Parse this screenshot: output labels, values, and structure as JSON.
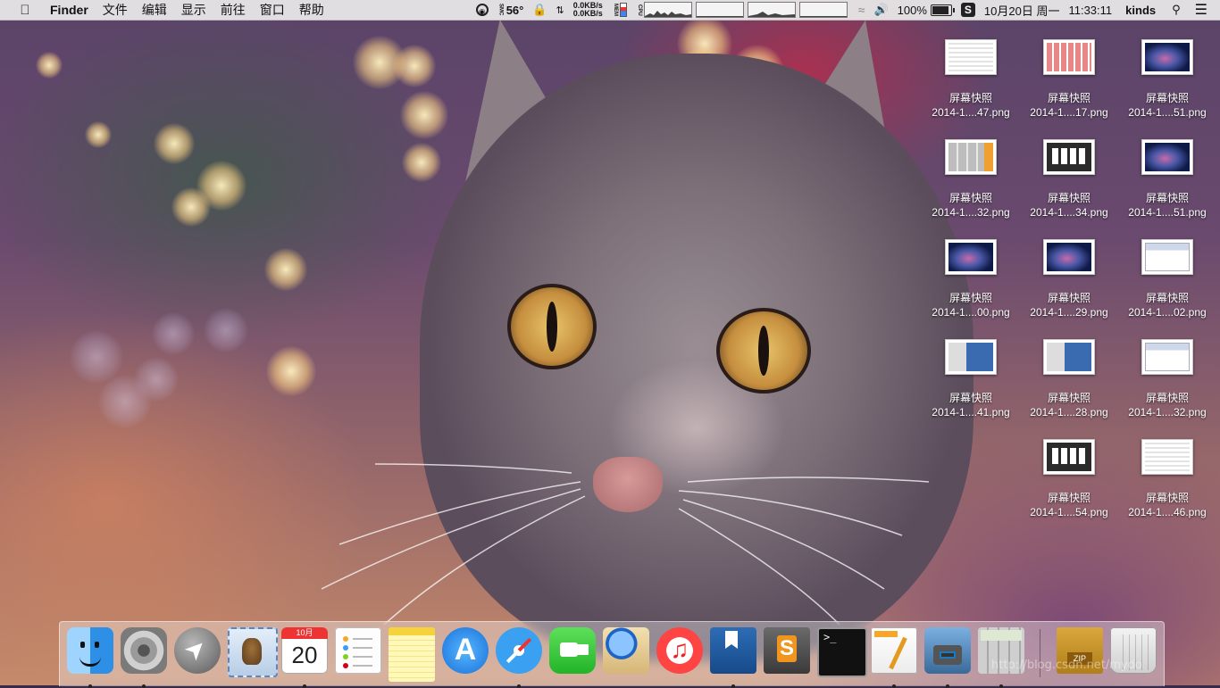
{
  "menubar": {
    "apple_icon": "apple-logo-icon",
    "app_name": "Finder",
    "menus": [
      "文件",
      "编辑",
      "显示",
      "前往",
      "窗口",
      "帮助"
    ],
    "status": {
      "istat_temp_prefix": "SMC",
      "temperature": "56°",
      "net_up": "0.0KB/s",
      "net_down": "0.0KB/s",
      "mem_label": "MEM",
      "cpu_label": "CPU",
      "battery_percent": "100%",
      "battery_level": 1.0,
      "input_method": "S",
      "date": "10月20日 周一",
      "time": "11:33:11",
      "user": "kinds"
    }
  },
  "desktop_icons": [
    {
      "name": "屏幕快照",
      "file": "2014-1....47.png",
      "thumb": "doc"
    },
    {
      "name": "屏幕快照",
      "file": "2014-1....17.png",
      "thumb": "grid"
    },
    {
      "name": "屏幕快照",
      "file": "2014-1....51.png",
      "thumb": "space"
    },
    {
      "name": "屏幕快照",
      "file": "2014-1....32.png",
      "thumb": "calc"
    },
    {
      "name": "屏幕快照",
      "file": "2014-1....34.png",
      "thumb": "dark"
    },
    {
      "name": "屏幕快照",
      "file": "2014-1....51.png",
      "thumb": "space"
    },
    {
      "name": "屏幕快照",
      "file": "2014-1....00.png",
      "thumb": "space"
    },
    {
      "name": "屏幕快照",
      "file": "2014-1....29.png",
      "thumb": "space"
    },
    {
      "name": "屏幕快照",
      "file": "2014-1....02.png",
      "thumb": "window"
    },
    {
      "name": "屏幕快照",
      "file": "2014-1....41.png",
      "thumb": "mixed"
    },
    {
      "name": "屏幕快照",
      "file": "2014-1....28.png",
      "thumb": "mixed"
    },
    {
      "name": "屏幕快照",
      "file": "2014-1....32.png",
      "thumb": "window"
    },
    {
      "name": "屏幕快照",
      "file": "2014-1....54.png",
      "thumb": "dark"
    },
    {
      "name": "屏幕快照",
      "file": "2014-1....46.png",
      "thumb": "doc"
    }
  ],
  "dock": {
    "calendar_month": "10月",
    "calendar_day": "20",
    "items": [
      {
        "name": "finder-icon",
        "running": true
      },
      {
        "name": "system-preferences-icon",
        "running": true
      },
      {
        "name": "launchpad-icon",
        "running": false
      },
      {
        "name": "mail-icon",
        "running": false
      },
      {
        "name": "calendar-icon",
        "running": true
      },
      {
        "name": "reminders-icon",
        "running": false
      },
      {
        "name": "notes-icon",
        "running": false
      },
      {
        "name": "app-store-icon",
        "running": false
      },
      {
        "name": "safari-icon",
        "running": true
      },
      {
        "name": "facetime-icon",
        "running": false
      },
      {
        "name": "preview-icon",
        "running": false
      },
      {
        "name": "itunes-icon",
        "running": false
      },
      {
        "name": "dictionary-icon",
        "running": true
      },
      {
        "name": "sublime-text-icon",
        "running": false
      },
      {
        "name": "terminal-icon",
        "running": false
      },
      {
        "name": "pages-icon",
        "running": true
      },
      {
        "name": "iphoto-icon",
        "running": true
      },
      {
        "name": "calculator-icon",
        "running": true
      },
      {
        "name": "archive-utility-icon",
        "running": false
      },
      {
        "name": "trash-icon",
        "running": false
      }
    ]
  },
  "watermark": "http://blog.csdn.net/mydo"
}
